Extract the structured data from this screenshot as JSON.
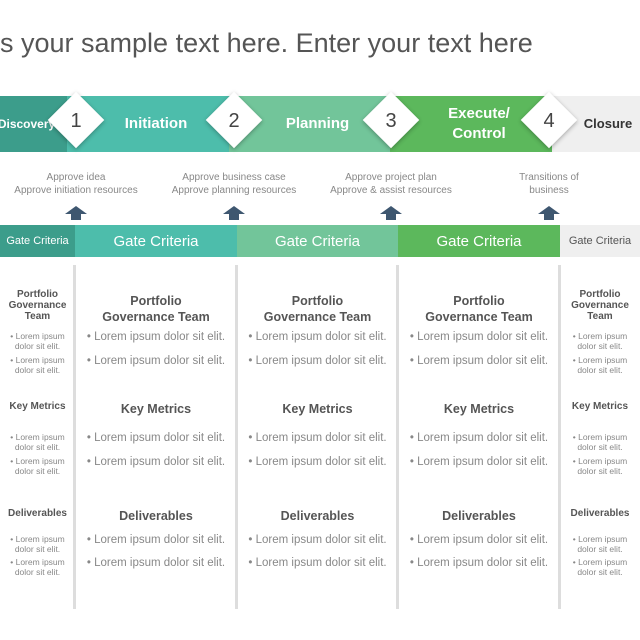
{
  "title": "s your sample text here. Enter your text here",
  "colors": {
    "discovery": "#3c9d8b",
    "initiation": "#4dbdab",
    "planning": "#72c59a",
    "execute": "#5cb85c",
    "closure": "#efefef",
    "arrow": "#3e5770"
  },
  "stages": [
    {
      "label": "Discovery",
      "gate": "Gate Criteria"
    },
    {
      "label": "Initiation",
      "gate": "Gate Criteria"
    },
    {
      "label": "Planning",
      "gate": "Gate Criteria"
    },
    {
      "label": "Execute/ Control",
      "gate": "Gate Criteria"
    },
    {
      "label": "Closure",
      "gate": "Gate Criteria"
    }
  ],
  "gates": [
    {
      "number": "1",
      "line1": "Approve idea",
      "line2": "Approve initiation resources"
    },
    {
      "number": "2",
      "line1": "Approve business case",
      "line2": "Approve planning resources"
    },
    {
      "number": "3",
      "line1": "Approve project plan",
      "line2": "Approve & assist resources"
    },
    {
      "number": "4",
      "line1": "Transitions of",
      "line2": "business"
    }
  ],
  "column": {
    "governance": "Portfolio Governance Team",
    "metrics": "Key Metrics",
    "deliverables": "Deliverables",
    "bullet": "• Lorem ipsum dolor sit elit."
  }
}
